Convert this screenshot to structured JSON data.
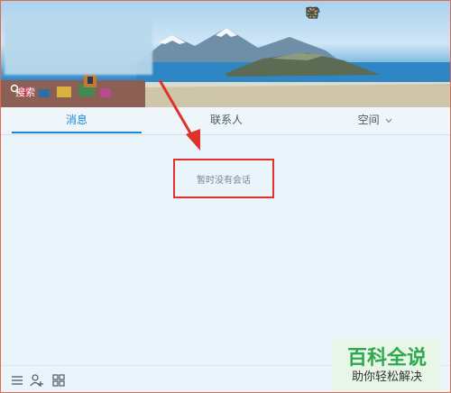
{
  "header": {
    "search_text": "搜索",
    "icons": [
      "star-badge-icon",
      "tshirt-icon",
      "mail-icon",
      "plus-icon",
      "minimize-icon",
      "close-icon"
    ]
  },
  "tabs": [
    {
      "label": "消息",
      "active": true
    },
    {
      "label": "联系人",
      "active": false
    },
    {
      "label": "空间",
      "active": false,
      "has_dropdown": true
    }
  ],
  "messages": {
    "empty_text": "暂时没有会话"
  },
  "bottom_bar": {
    "icons": [
      "menu-icon",
      "add-contact-icon",
      "app-manager-icon"
    ]
  },
  "watermark": {
    "title": "百科全说",
    "subtitle": "助你轻松解决"
  },
  "colors": {
    "accent": "#1d87d7",
    "highlight": "#e0312b",
    "watermark_green": "#2fa84f"
  }
}
